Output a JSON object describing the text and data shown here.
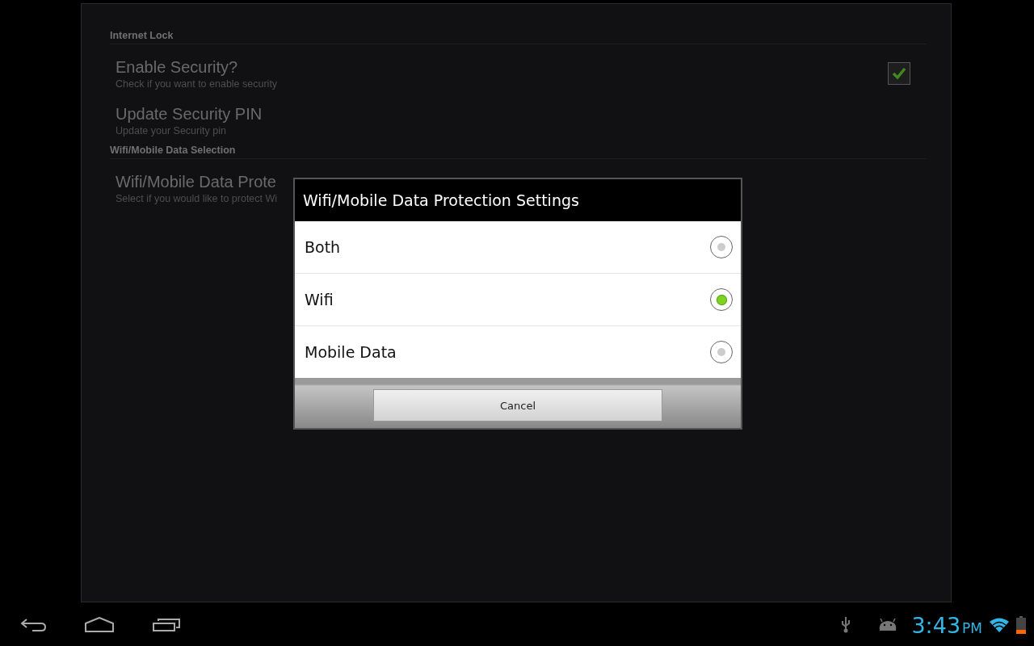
{
  "settings": [
    {
      "kind": "category",
      "title": "Internet Lock"
    },
    {
      "kind": "checkbox",
      "title": "Enable Security?",
      "summary": "Check if you want to enable security",
      "checked": true
    },
    {
      "kind": "plain",
      "title": "Update Security PIN",
      "summary": "Update your Security pin"
    },
    {
      "kind": "category",
      "title": "Wifi/Mobile Data Selection"
    },
    {
      "kind": "plain",
      "title": "Wifi/Mobile Data Prote",
      "summary": "Select if you would like to protect Wi"
    }
  ],
  "dialog": {
    "title": "Wifi/Mobile Data Protection Settings",
    "options": [
      {
        "label": "Both",
        "selected": false
      },
      {
        "label": "Wifi",
        "selected": true
      },
      {
        "label": "Mobile Data",
        "selected": false
      }
    ],
    "button": "Cancel"
  },
  "status_bar": {
    "time": "3:43",
    "ampm": "PM"
  }
}
